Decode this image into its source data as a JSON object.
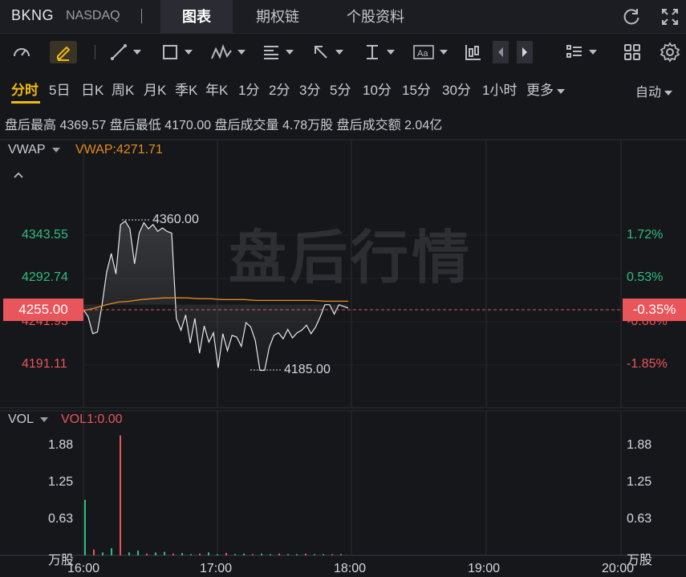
{
  "header": {
    "symbol": "BKNG",
    "exchange": "NASDAQ",
    "tabs": [
      "图表",
      "期权链",
      "个股资料"
    ],
    "active_tab": 0
  },
  "periods": {
    "items": [
      "分时",
      "5日",
      "日K",
      "周K",
      "月K",
      "季K",
      "年K",
      "1分",
      "2分",
      "3分",
      "5分",
      "10分",
      "15分",
      "30分",
      "1小时",
      "更多"
    ],
    "active": 0,
    "auto_label": "自动"
  },
  "info": {
    "high_label": "盘后最高",
    "high_value": "4369.57",
    "low_label": "盘后最低",
    "low_value": "4170.00",
    "volume_label": "盘后成交量",
    "volume_value": "4.78万股",
    "amount_label": "盘后成交额",
    "amount_value": "2.04亿"
  },
  "price_panel": {
    "indicator": "VWAP",
    "indicator_value": "VWAP:4271.71",
    "left_axis": [
      "4343.55",
      "4292.74",
      "4241.93",
      "4191.11"
    ],
    "right_axis": [
      "1.72%",
      "0.53%",
      "-0.66%",
      "-1.85%"
    ],
    "current_price": "4255.00",
    "current_pct": "-0.35%",
    "max_label": "4360.00",
    "min_label": "4185.00",
    "watermark": "盘后行情"
  },
  "volume_panel": {
    "indicator": "VOL",
    "indicator_value": "VOL1:0.00",
    "axis": [
      "1.88",
      "1.25",
      "0.63"
    ],
    "unit": "万股"
  },
  "x_axis": [
    "16:00",
    "17:00",
    "18:00",
    "19:00",
    "20:00"
  ],
  "colors": {
    "up": "#2fbd7e",
    "down": "#e8555a",
    "accent": "#f0b90b",
    "vwap": "#e58c1c",
    "price_line": "#e6e8ec"
  },
  "chart_data": {
    "type": "line",
    "x_range": [
      "16:00",
      "20:00"
    ],
    "ylim": [
      4170,
      4370
    ],
    "series": [
      {
        "name": "VWAP",
        "values": [
          4255,
          4258,
          4262,
          4265,
          4266,
          4268,
          4269,
          4270,
          4270,
          4270,
          4269,
          4269,
          4268,
          4268,
          4268,
          4267,
          4267,
          4267,
          4267,
          4267,
          4267,
          4266,
          4266,
          4266
        ]
      }
    ],
    "price": [
      4256,
      4248,
      4228,
      4230,
      4262,
      4300,
      4322,
      4298,
      4356,
      4360,
      4351,
      4310,
      4346,
      4358,
      4351,
      4356,
      4348,
      4352,
      4348,
      4346,
      4246,
      4232,
      4250,
      4217,
      4246,
      4205,
      4237,
      4218,
      4229,
      4188,
      4228,
      4208,
      4226,
      4224,
      4213,
      4241,
      4236,
      4220,
      4185,
      4185,
      4212,
      4226,
      4229,
      4222,
      4233,
      4223,
      4229,
      4232,
      4238,
      4228,
      4236,
      4248,
      4262,
      4262,
      4251,
      4262,
      4260,
      4258
    ],
    "volume": [
      0.95,
      0.1,
      0.05,
      0.12,
      2.05,
      0.05,
      0.08,
      0.03,
      0.05,
      0.06,
      0.03,
      0.04,
      0.02,
      0.03,
      0.05,
      0.02,
      0.04,
      0.02,
      0.03,
      0.02,
      0.03,
      0.02,
      0.03,
      0.02,
      0.02,
      0.03,
      0.02,
      0.02,
      0.02,
      0.02
    ]
  }
}
